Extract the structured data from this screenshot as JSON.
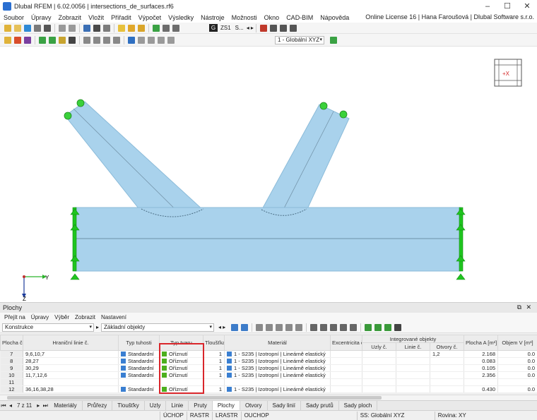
{
  "window": {
    "title": "Dlubal RFEM | 6.02.0056 | intersections_de_surfaces.rf6",
    "controls": [
      "–",
      "☐",
      "✕"
    ]
  },
  "menubar": {
    "items": [
      "Soubor",
      "Úpravy",
      "Zobrazit",
      "Vložit",
      "Přiřadit",
      "Výpočet",
      "Výsledky",
      "Nástroje",
      "Možnosti",
      "Okno",
      "CAD-BIM",
      "Nápověda"
    ],
    "license": "Online License 16 | Hana Faroušová | Dlubal Software s.r.o."
  },
  "toolbar": {
    "load_case_code": "G",
    "load_case_name": "ZS1",
    "load_case_suffix": "S...",
    "coordinate_system": "1 - Globální XYZ"
  },
  "viewport": {
    "view_cube_label": "+X",
    "axis_y": "Y",
    "axis_z": "Z",
    "colors": {
      "surface": "#a9d2ec",
      "support": "#1fc51f",
      "node": "#3ad13a"
    }
  },
  "panel": {
    "title": "Plochy",
    "menu": [
      "Přejít na",
      "Úpravy",
      "Výběr",
      "Zobrazit",
      "Nastavení"
    ],
    "category": "Konstrukce",
    "object_filter": "Základní objekty",
    "columns": {
      "plocha": "Plocha č.",
      "hranicni": "Hraniční linie č.",
      "typ_tuhosti": "Typ tuhosti",
      "typ_tvaru": "Typ tvaru",
      "tloustka": "Tloušťka č.",
      "material": "Materiál",
      "excentricita": "Excentricita č.",
      "integrovane": "Integrované objekty",
      "uzly": "Uzly č.",
      "linie": "Linie č.",
      "otvory": "Otvory č.",
      "plocha_a": "Plocha A [m²]",
      "objem": "Objem V [m³]"
    },
    "rows": [
      {
        "no": "7",
        "lines": "9,6,10,7",
        "stiffness": "Standardní",
        "shape": "Oříznutí",
        "thickness": "1",
        "material": "1 - S235 | Izotropní | Lineárně elastický",
        "openings": "1,2",
        "area": "2.168",
        "volume": "0.0"
      },
      {
        "no": "8",
        "lines": "28,27",
        "stiffness": "Standardní",
        "shape": "Oříznutí",
        "thickness": "1",
        "material": "1 - S235 | Izotropní | Lineárně elastický",
        "openings": "",
        "area": "0.083",
        "volume": "0.0"
      },
      {
        "no": "9",
        "lines": "30,29",
        "stiffness": "Standardní",
        "shape": "Oříznutí",
        "thickness": "1",
        "material": "1 - S235 | Izotropní | Lineárně elastický",
        "openings": "",
        "area": "0.105",
        "volume": "0.0"
      },
      {
        "no": "10",
        "lines": "11,7,12,6",
        "stiffness": "Standardní",
        "shape": "Oříznutí",
        "thickness": "1",
        "material": "1 - S235 | Izotropní | Lineárně elastický",
        "openings": "",
        "area": "2.356",
        "volume": "0.0"
      },
      {
        "no": "11",
        "lines": "",
        "stiffness": "",
        "shape": "",
        "thickness": "",
        "material": "",
        "openings": "",
        "area": "",
        "volume": ""
      },
      {
        "no": "12",
        "lines": "36,16,38,28",
        "stiffness": "Standardní",
        "shape": "Oříznutí",
        "thickness": "1",
        "material": "1 - S235 | Izotropní | Lineárně elastický",
        "openings": "",
        "area": "0.430",
        "volume": "0.0"
      }
    ],
    "pager": "7 z 11",
    "tabs": [
      "Materiály",
      "Průřezy",
      "Tloušťky",
      "Uzly",
      "Linie",
      "Pruty",
      "Plochy",
      "Otvory",
      "Sady linií",
      "Sady prutů",
      "Sady ploch"
    ],
    "active_tab": "Plochy",
    "swatch_color": "#3a7fd1",
    "shape_swatch_color": "#4caf1e"
  },
  "status": {
    "toggles": [
      "ÚCHOP",
      "RASTR",
      "LRASTR",
      "OUCHOP"
    ],
    "cs": "SS: Globální XYZ",
    "plane": "Rovina: XY"
  }
}
